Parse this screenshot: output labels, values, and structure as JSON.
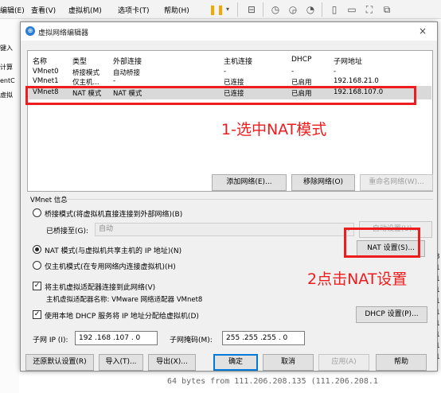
{
  "menubar": {
    "items": [
      "编辑(E)",
      "查看(V)",
      "虚拟机(M)",
      "选项卡(T)",
      "帮助(H)"
    ]
  },
  "left_strip": [
    "键入",
    "计算",
    "entC",
    "虚拟"
  ],
  "right_term": [
    "8",
    "1",
    "1",
    "1",
    "1",
    "1",
    "1",
    "1",
    "1",
    "1"
  ],
  "bottom_term": "64 bytes from 111.206.208.135 (111.206.208.1",
  "dialog": {
    "title": "虚拟网络编辑器",
    "close": "×",
    "columns": [
      "名称",
      "类型",
      "外部连接",
      "主机连接",
      "DHCP",
      "子网地址"
    ],
    "rows": [
      [
        "VMnet0",
        "桥接模式",
        "自动桥接",
        "-",
        "-",
        "-"
      ],
      [
        "VMnet1",
        "仅主机...",
        "-",
        "已连接",
        "已启用",
        "192.168.21.0"
      ],
      [
        "VMnet8",
        "NAT 模式",
        "NAT 模式",
        "已连接",
        "已启用",
        "192.168.107.0"
      ]
    ],
    "buttons_top": {
      "add": "添加网络(E)...",
      "remove": "移除网络(O)",
      "rename": "重命名网络(W)..."
    },
    "group_title": "VMnet 信息",
    "bridge_option": "桥接模式(将虚拟机直接连接到外部网络)(B)",
    "bridged_to_label": "已桥接至(G):",
    "bridged_to_value": "自动",
    "auto_settings": "自动设置(U)...",
    "nat_option": "NAT 模式(与虚拟机共享主机的 IP 地址)(N)",
    "nat_settings": "NAT 设置(S)...",
    "hostonly_option": "仅主机模式(在专用网络内连接虚拟机)(H)",
    "connect_adapter": "将主机虚拟适配器连接到此网络(V)",
    "adapter_name": "主机虚拟适配器名称: VMware 网络适配器 VMnet8",
    "use_dhcp": "使用本地 DHCP 服务将 IP 地址分配给虚拟机(D)",
    "dhcp_settings": "DHCP 设置(P)...",
    "subnet_ip_label": "子网 IP (I):",
    "subnet_ip": "192 .168 .107 . 0",
    "subnet_mask_label": "子网掩码(M):",
    "subnet_mask": "255 .255 .255 . 0",
    "buttons_bottom": {
      "restore": "还原默认设置(R)",
      "import": "导入(T)...",
      "export": "导出(X)...",
      "ok": "确定",
      "cancel": "取消",
      "apply": "应用(A)",
      "help": "帮助"
    }
  },
  "annotations": {
    "step1": "1-选中NAT模式",
    "step2": "2点击NAT设置"
  },
  "colors": {
    "annotation": "#ee1c1c",
    "accent": "#0078d7",
    "toolbar_pause": "#f0a800"
  }
}
